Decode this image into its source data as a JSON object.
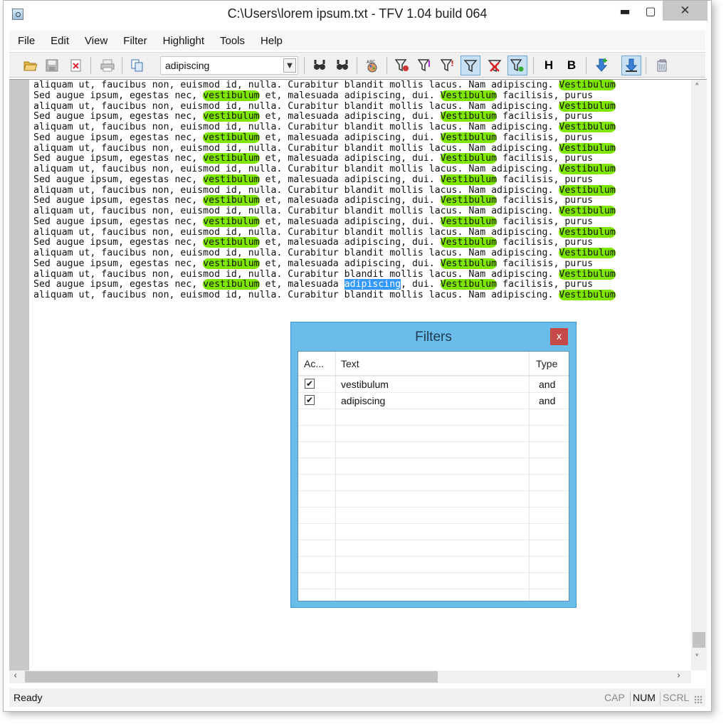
{
  "window": {
    "title": "C:\\Users\\lorem ipsum.txt - TFV 1.04 build 064",
    "minimize": "▬",
    "maximize": "▢",
    "close": "✕"
  },
  "menu": [
    {
      "label": "File"
    },
    {
      "label": "Edit"
    },
    {
      "label": "View"
    },
    {
      "label": "Filter"
    },
    {
      "label": "Highlight"
    },
    {
      "label": "Tools"
    },
    {
      "label": "Help"
    }
  ],
  "toolbar": {
    "search_value": "adipiscing",
    "combo_arrow": "▼",
    "bold_label": "B",
    "highlight_label": "H",
    "icons": [
      "open-folder-icon",
      "save-icon",
      "save-as-icon",
      "print-icon",
      "copy-icon",
      "find-next-icon",
      "find-prev-icon",
      "spellcheck-icon",
      "add-filter-icon",
      "edit-filter-icon",
      "important-filter-icon",
      "filter-active-icon",
      "remove-filter-icon",
      "filter-options-icon",
      "highlight-icon",
      "bold-icon",
      "scroll-to-end-icon",
      "autoscroll-icon",
      "clear-icon"
    ]
  },
  "editor": {
    "line_a": "aliquam ut, faucibus non, euismod id, nulla. Curabitur blandit mollis lacus. Nam adipiscing. Vestibulum",
    "line_b_pre": "Sed augue ipsum, egestas nec, ",
    "line_b_hl1": "vestibulum",
    "line_b_mid1": " et, malesuada ",
    "line_b_word": "adipiscing",
    "line_b_mid2": ", dui. ",
    "line_b_hl2": "Vestibulum",
    "line_b_post": " facilisis, purus",
    "line_a_pre": "aliquam ut, faucibus non, euismod id, nulla. Curabitur blandit mollis lacus. Nam adipiscing. ",
    "line_a_hl": "Vestibulum",
    "selected_line_index": 19
  },
  "status": {
    "text": "Ready",
    "cap": "CAP",
    "num": "NUM",
    "scrl": "SCRL"
  },
  "filters_dialog": {
    "title": "Filters",
    "close": "x",
    "columns": [
      "Ac...",
      "Text",
      "Type"
    ],
    "rows": [
      {
        "active": "✔",
        "text": "vestibulum",
        "type": "and"
      },
      {
        "active": "✔",
        "text": "adipiscing",
        "type": "and"
      }
    ]
  },
  "colors": {
    "highlight": "#7fe600",
    "selection": "#3399ff",
    "dialog": "#6bbde9"
  }
}
